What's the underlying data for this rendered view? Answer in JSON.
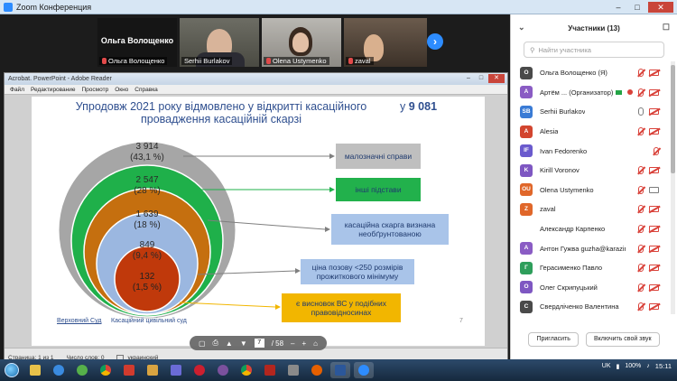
{
  "zoom": {
    "window_title": "Zoom Конференция",
    "strip": {
      "tiles": [
        {
          "name": "Ольга Волощенко",
          "big_name": "Ольга Волощенко",
          "muted": true
        },
        {
          "name": "Serhii Burlakov",
          "muted": false
        },
        {
          "name": "Olena Ustymenko",
          "muted": true
        },
        {
          "name": "zaval",
          "muted": true
        }
      ],
      "next_glyph": "›"
    }
  },
  "acrobat": {
    "window_title": "Acrobat. PowerPoint - Adobe Reader",
    "menu": [
      "Файл",
      "Редактирование",
      "Просмотр",
      "Окно",
      "Справка"
    ],
    "status": {
      "page": "Страница: 1 из 1",
      "words": "Число слов: 0",
      "language": "украинский"
    },
    "toolbar": {
      "page_current": "7",
      "page_total": "/ 58"
    }
  },
  "slide": {
    "title": "Упродовж 2021 року відмовлено у відкритті касаційного провадження касаційній скарзі",
    "count_prefix": "у",
    "count_value": "9 081",
    "circles": [
      {
        "value": "3 914",
        "percent": "(43,1 %)",
        "color": "#a6a6a6",
        "label": "малозначні справи",
        "label_color": "#bfbfbf"
      },
      {
        "value": "2 547",
        "percent": "(28 %)",
        "color": "#1fb04a",
        "label": "інші підстави",
        "label_color": "#22b14c"
      },
      {
        "value": "1 639",
        "percent": "(18 %)",
        "color": "#c56f0f",
        "label": "касаційна скарга визнана необґрунтованою",
        "label_color": "#a9c4e9"
      },
      {
        "value": "849",
        "percent": "(9,4 %)",
        "color": "#9bb7e0",
        "label": "ціна позову <250 розмірів прожиткового мінімуму",
        "label_color": "#a9c4e9"
      },
      {
        "value": "132",
        "percent": "(1,5 %)",
        "color": "#c0390b",
        "label": "є висновок ВС у подібних правовідносинах",
        "label_color": "#f2b600"
      }
    ],
    "legend_a": "Верховний Суд",
    "legend_b": "Касаційний цивільний суд",
    "slide_number": "7"
  },
  "panel": {
    "title": "Участники (13)",
    "search_placeholder": "Найти участника",
    "participants": [
      {
        "initials": "О",
        "color": "#4a4a4a",
        "name": "Ольга Волощенко (Я)",
        "mic": "off",
        "cam": "off"
      },
      {
        "initials": "А",
        "color": "#8a5cc4",
        "name": "Артём ... (Организатор)",
        "mic": "off",
        "cam": "off",
        "host": true
      },
      {
        "initials": "SB",
        "color": "#3a7bd5",
        "name": "Serhii Burlakov",
        "mic": "on",
        "cam": "off"
      },
      {
        "initials": "A",
        "color": "#d2452f",
        "name": "Alesia",
        "mic": "off",
        "cam": "off"
      },
      {
        "initials": "IF",
        "color": "#6a5acd",
        "name": "Ivan Fedorenko",
        "mic": "off",
        "cam": "none"
      },
      {
        "initials": "K",
        "color": "#7e57c2",
        "name": "Kirill Voronov",
        "mic": "off",
        "cam": "off"
      },
      {
        "initials": "OU",
        "color": "#e0672a",
        "name": "Olena Ustymenko",
        "mic": "off",
        "cam": "on"
      },
      {
        "initials": "Z",
        "color": "#e0672a",
        "name": "zaval",
        "mic": "off",
        "cam": "off"
      },
      {
        "initials": "",
        "color": "#ffffff",
        "name": "Александр Карпенко",
        "mic": "off",
        "cam": "off"
      },
      {
        "initials": "А",
        "color": "#8a5cc4",
        "name": "Антон Гужва guzha@karazin.ua",
        "mic": "off",
        "cam": "off"
      },
      {
        "initials": "Г",
        "color": "#2e9e5b",
        "name": "Герасименко Павло",
        "mic": "off",
        "cam": "off"
      },
      {
        "initials": "О",
        "color": "#7e57c2",
        "name": "Олег Скрипуцький",
        "mic": "off",
        "cam": "off"
      },
      {
        "initials": "С",
        "color": "#4a4a4a",
        "name": "Свердліченко Валентина",
        "mic": "off",
        "cam": "off"
      }
    ],
    "invite_label": "Пригласить",
    "unmute_label": "Включить свой звук"
  },
  "taskbar": {
    "lang": "UK",
    "battery": "100%",
    "clock": "15:11"
  }
}
